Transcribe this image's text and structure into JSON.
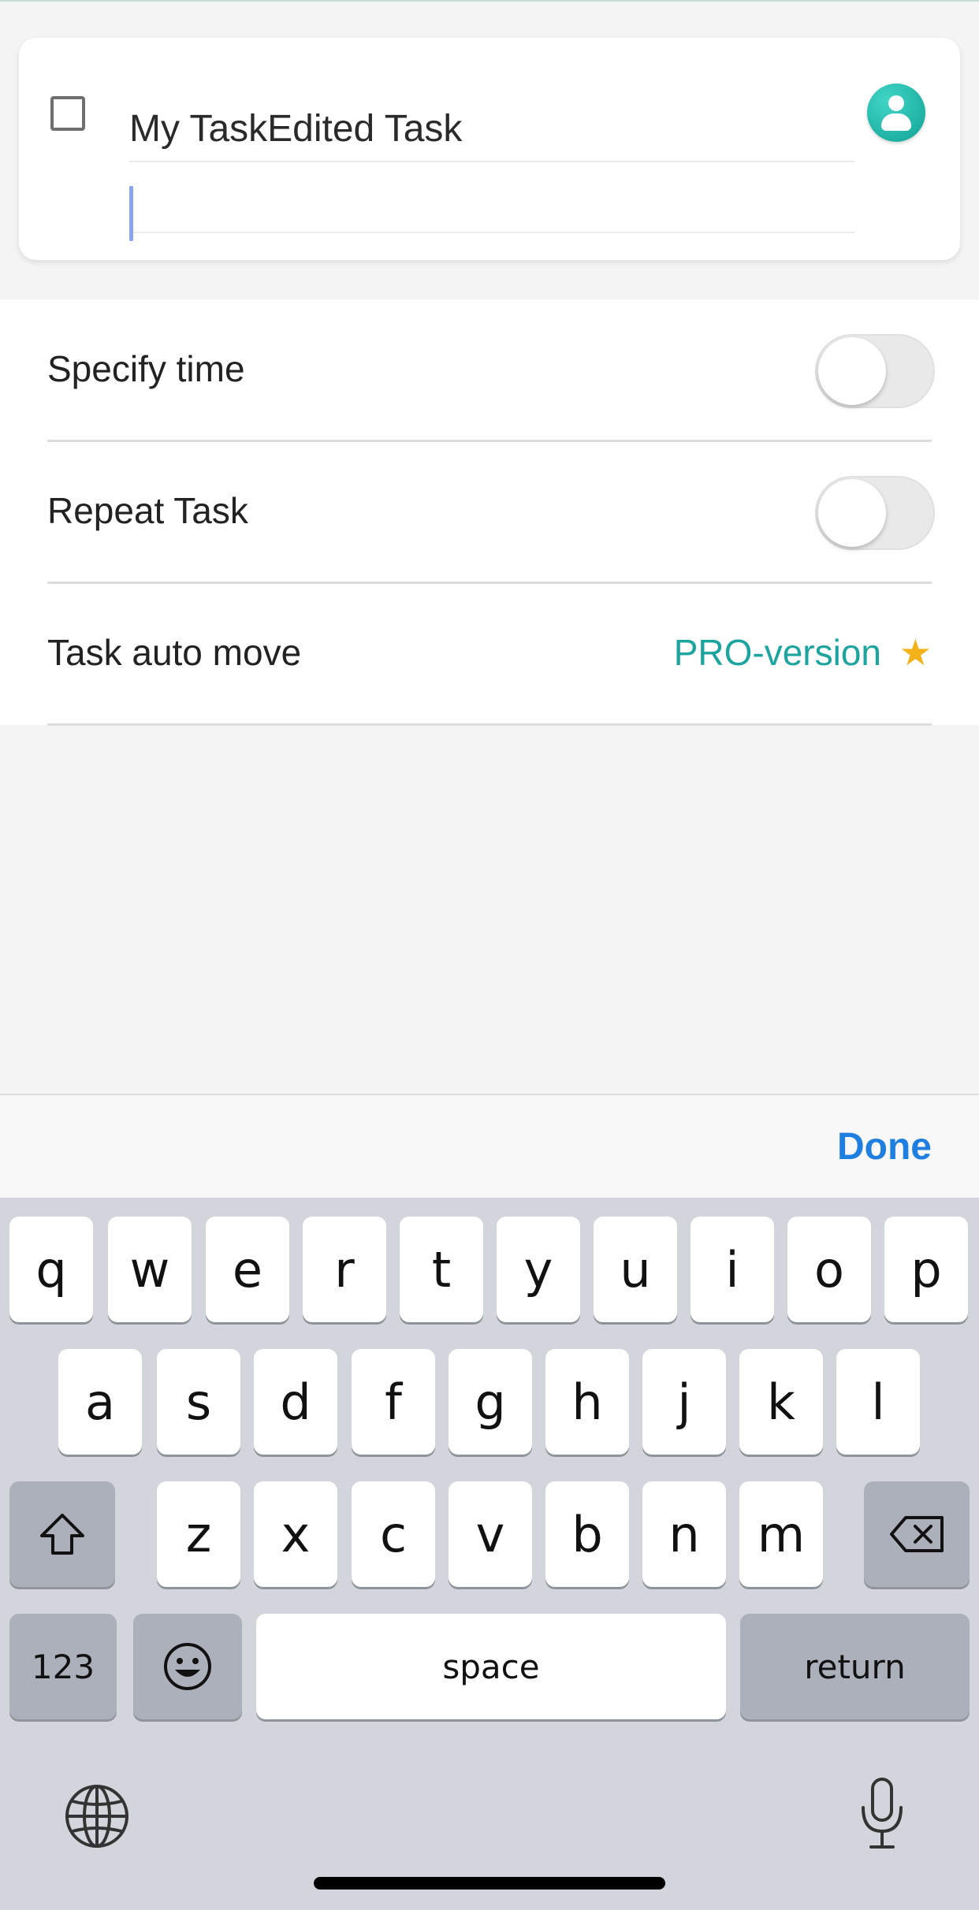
{
  "task": {
    "title": "My TaskEdited Task",
    "note": ""
  },
  "settings": {
    "items": [
      {
        "label": "Specify time",
        "toggle_on": false
      },
      {
        "label": "Repeat Task",
        "toggle_on": false
      },
      {
        "label": "Task auto move",
        "value": "PRO-version",
        "icon": "star-icon"
      }
    ]
  },
  "accessory": {
    "done_label": "Done"
  },
  "keyboard": {
    "row1": [
      "q",
      "w",
      "e",
      "r",
      "t",
      "y",
      "u",
      "i",
      "o",
      "p"
    ],
    "row2": [
      "a",
      "s",
      "d",
      "f",
      "g",
      "h",
      "j",
      "k",
      "l"
    ],
    "row3": [
      "z",
      "x",
      "c",
      "v",
      "b",
      "n",
      "m"
    ],
    "numbers_label": "123",
    "space_label": "space",
    "return_label": "return"
  },
  "colors": {
    "accent_teal": "#1ca59e",
    "done_blue": "#1f7fe0",
    "star_gold": "#f4b21a"
  }
}
